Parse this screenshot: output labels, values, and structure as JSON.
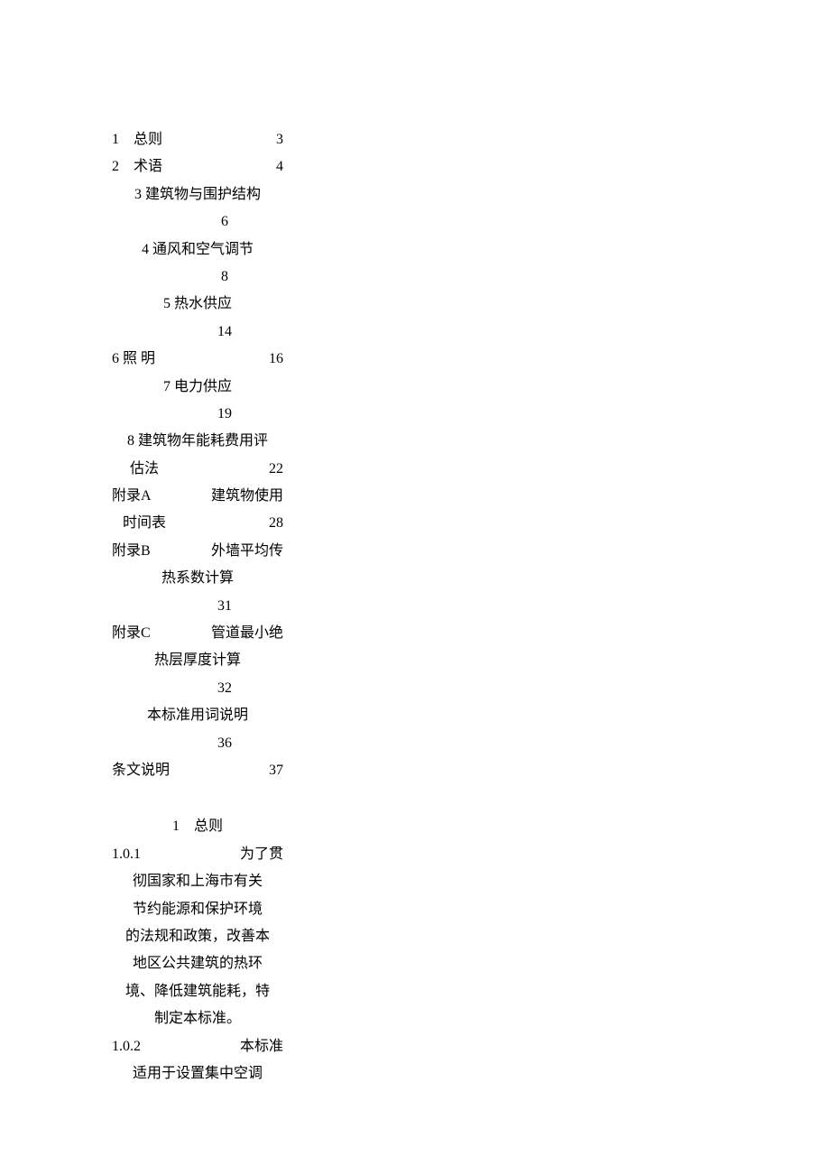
{
  "toc": [
    {
      "left": "1　总则",
      "right": "3"
    },
    {
      "left": "2　术语",
      "right": "4"
    },
    {
      "wrap": "3 建筑物与围护结构",
      "page": "6"
    },
    {
      "wrap": "4 通风和空气调节",
      "page": "8"
    },
    {
      "wrap": "5 热水供应",
      "page": "14"
    },
    {
      "left": "6 照 明",
      "right": "16"
    },
    {
      "wrap": "7 电力供应",
      "page": "19"
    },
    {
      "wrapA": "8 建筑物年能耗费用评",
      "wrapB_left": "估法",
      "wrapB_right": "22"
    },
    {
      "wrapA_left": "附录A",
      "wrapA_right": "建筑物使用",
      "wrapB_left": "时间表",
      "wrapB_right": "28"
    },
    {
      "wrapA_left": "附录B",
      "wrapA_right": "外墙平均传",
      "wrapB": "热系数计算",
      "page": "31"
    },
    {
      "wrapA_left": "附录C",
      "wrapA_right": "管道最小绝",
      "wrapB": "热层厚度计算",
      "page": "32"
    },
    {
      "wrap": "本标准用词说明",
      "page": "36"
    },
    {
      "left": "条文说明",
      "right": "37"
    }
  ],
  "section1": {
    "title": "1　总则",
    "clause1": {
      "num": "1.0.1",
      "tail": "为了贯",
      "lines": [
        "彻国家和上海市有关",
        "节约能源和保护环境",
        "的法规和政策，改善本",
        "地区公共建筑的热环",
        "境、降低建筑能耗，特",
        "制定本标准。"
      ]
    },
    "clause2": {
      "num": "1.0.2",
      "tail": "本标准",
      "lines": [
        "适用于设置集中空调"
      ]
    }
  }
}
